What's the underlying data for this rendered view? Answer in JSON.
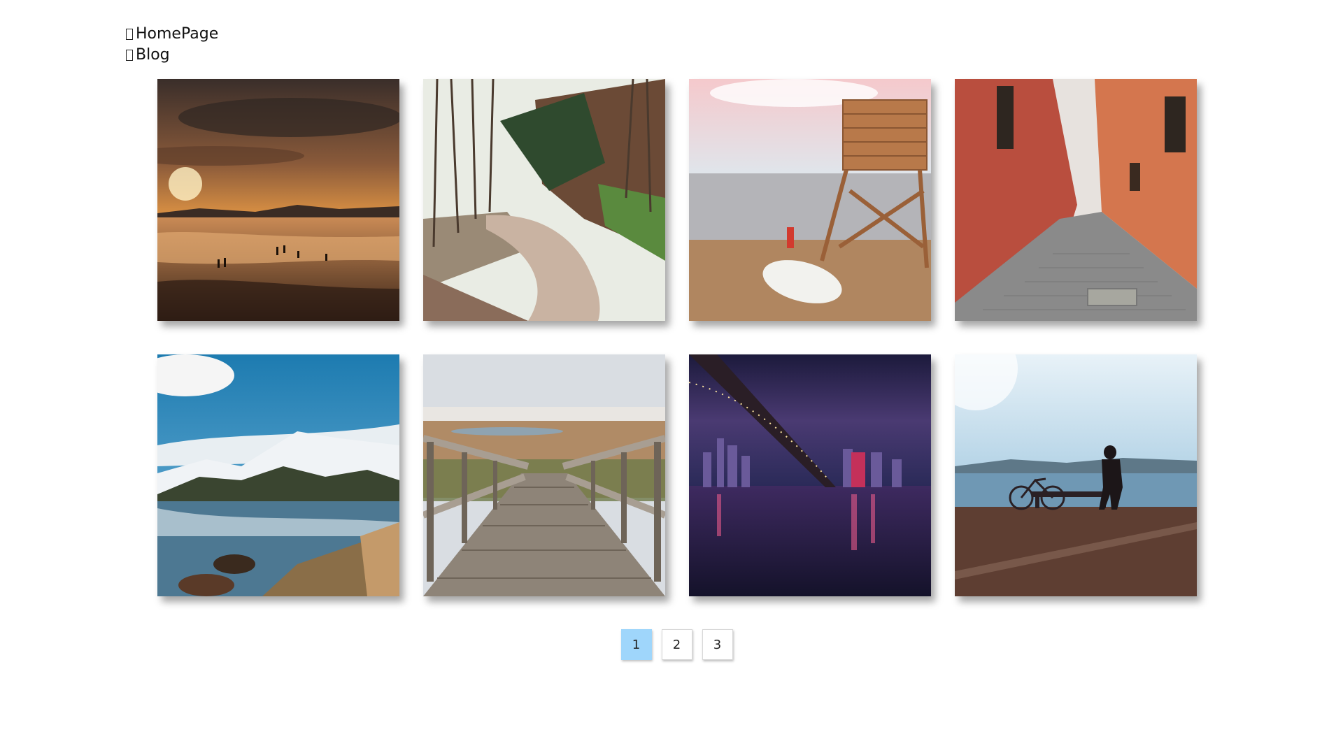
{
  "nav": {
    "items": [
      {
        "label": "HomePage",
        "icon": "missing-glyph-icon"
      },
      {
        "label": "Blog",
        "icon": "missing-glyph-icon"
      }
    ]
  },
  "gallery": {
    "photos": [
      {
        "subject": "sunset-beach"
      },
      {
        "subject": "forest-dirt-road"
      },
      {
        "subject": "lifeguard-tower-beach"
      },
      {
        "subject": "narrow-cobblestone-alley"
      },
      {
        "subject": "snowy-mountain-lake"
      },
      {
        "subject": "wooden-boardwalk"
      },
      {
        "subject": "city-bridge-night"
      },
      {
        "subject": "man-bicycle-waterfront"
      }
    ]
  },
  "pagination": {
    "pages": [
      "1",
      "2",
      "3"
    ],
    "active_page": "1",
    "active_color": "#9fd6fb"
  }
}
